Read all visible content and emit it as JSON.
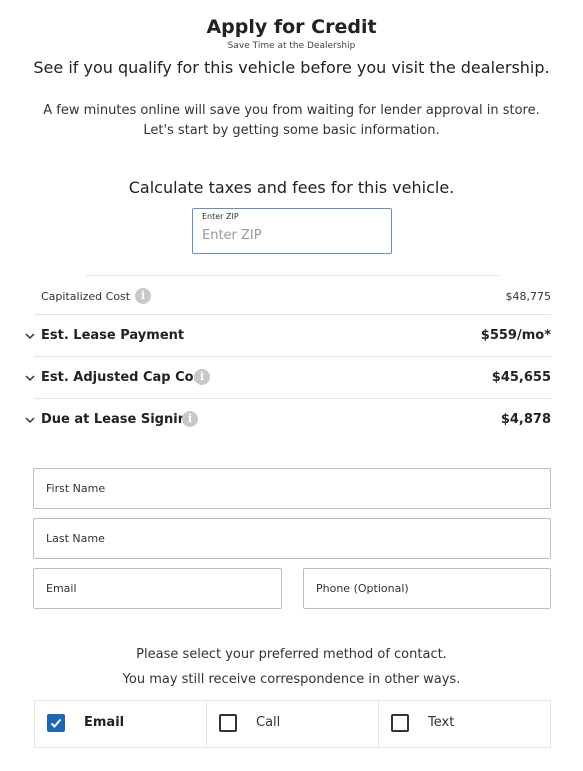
{
  "header": {
    "title": "Apply for Credit",
    "subtitle": "Save Time at the Dealership",
    "headline": "See if you qualify for this vehicle before you visit the dealership.",
    "intro": "A few minutes online will save you from waiting for lender approval in store. Let's start by getting some basic information."
  },
  "calculator": {
    "heading": "Calculate taxes and fees for this vehicle.",
    "zip_label": "Enter ZIP",
    "zip_placeholder": "Enter ZIP",
    "zip_value": ""
  },
  "pricing": {
    "capitalized_cost": {
      "label": "Capitalized Cost",
      "value": "$48,775"
    },
    "rows": [
      {
        "label": "Est. Lease Payment",
        "value": "$559/mo*",
        "has_info": false
      },
      {
        "label": "Est. Adjusted Cap Cost",
        "value": "$45,655",
        "has_info": true
      },
      {
        "label": "Due at Lease Signing",
        "value": "$4,878",
        "has_info": true
      }
    ],
    "info_icon": "info-icon",
    "chevron_icon": "chevron-down-icon"
  },
  "form": {
    "first_name_placeholder": "First Name",
    "last_name_placeholder": "Last Name",
    "email_placeholder": "Email",
    "phone_placeholder": "Phone (Optional)"
  },
  "contact": {
    "prompt_line1": "Please select your preferred method of contact.",
    "prompt_line2": "You may still receive correspondence in other ways.",
    "options": [
      {
        "label": "Email",
        "checked": true
      },
      {
        "label": "Call",
        "checked": false
      },
      {
        "label": "Text",
        "checked": false
      }
    ]
  },
  "colors": {
    "accent": "#1f66b3",
    "zip_border": "#6b8fb8",
    "info_icon": "#c8c8c8"
  }
}
